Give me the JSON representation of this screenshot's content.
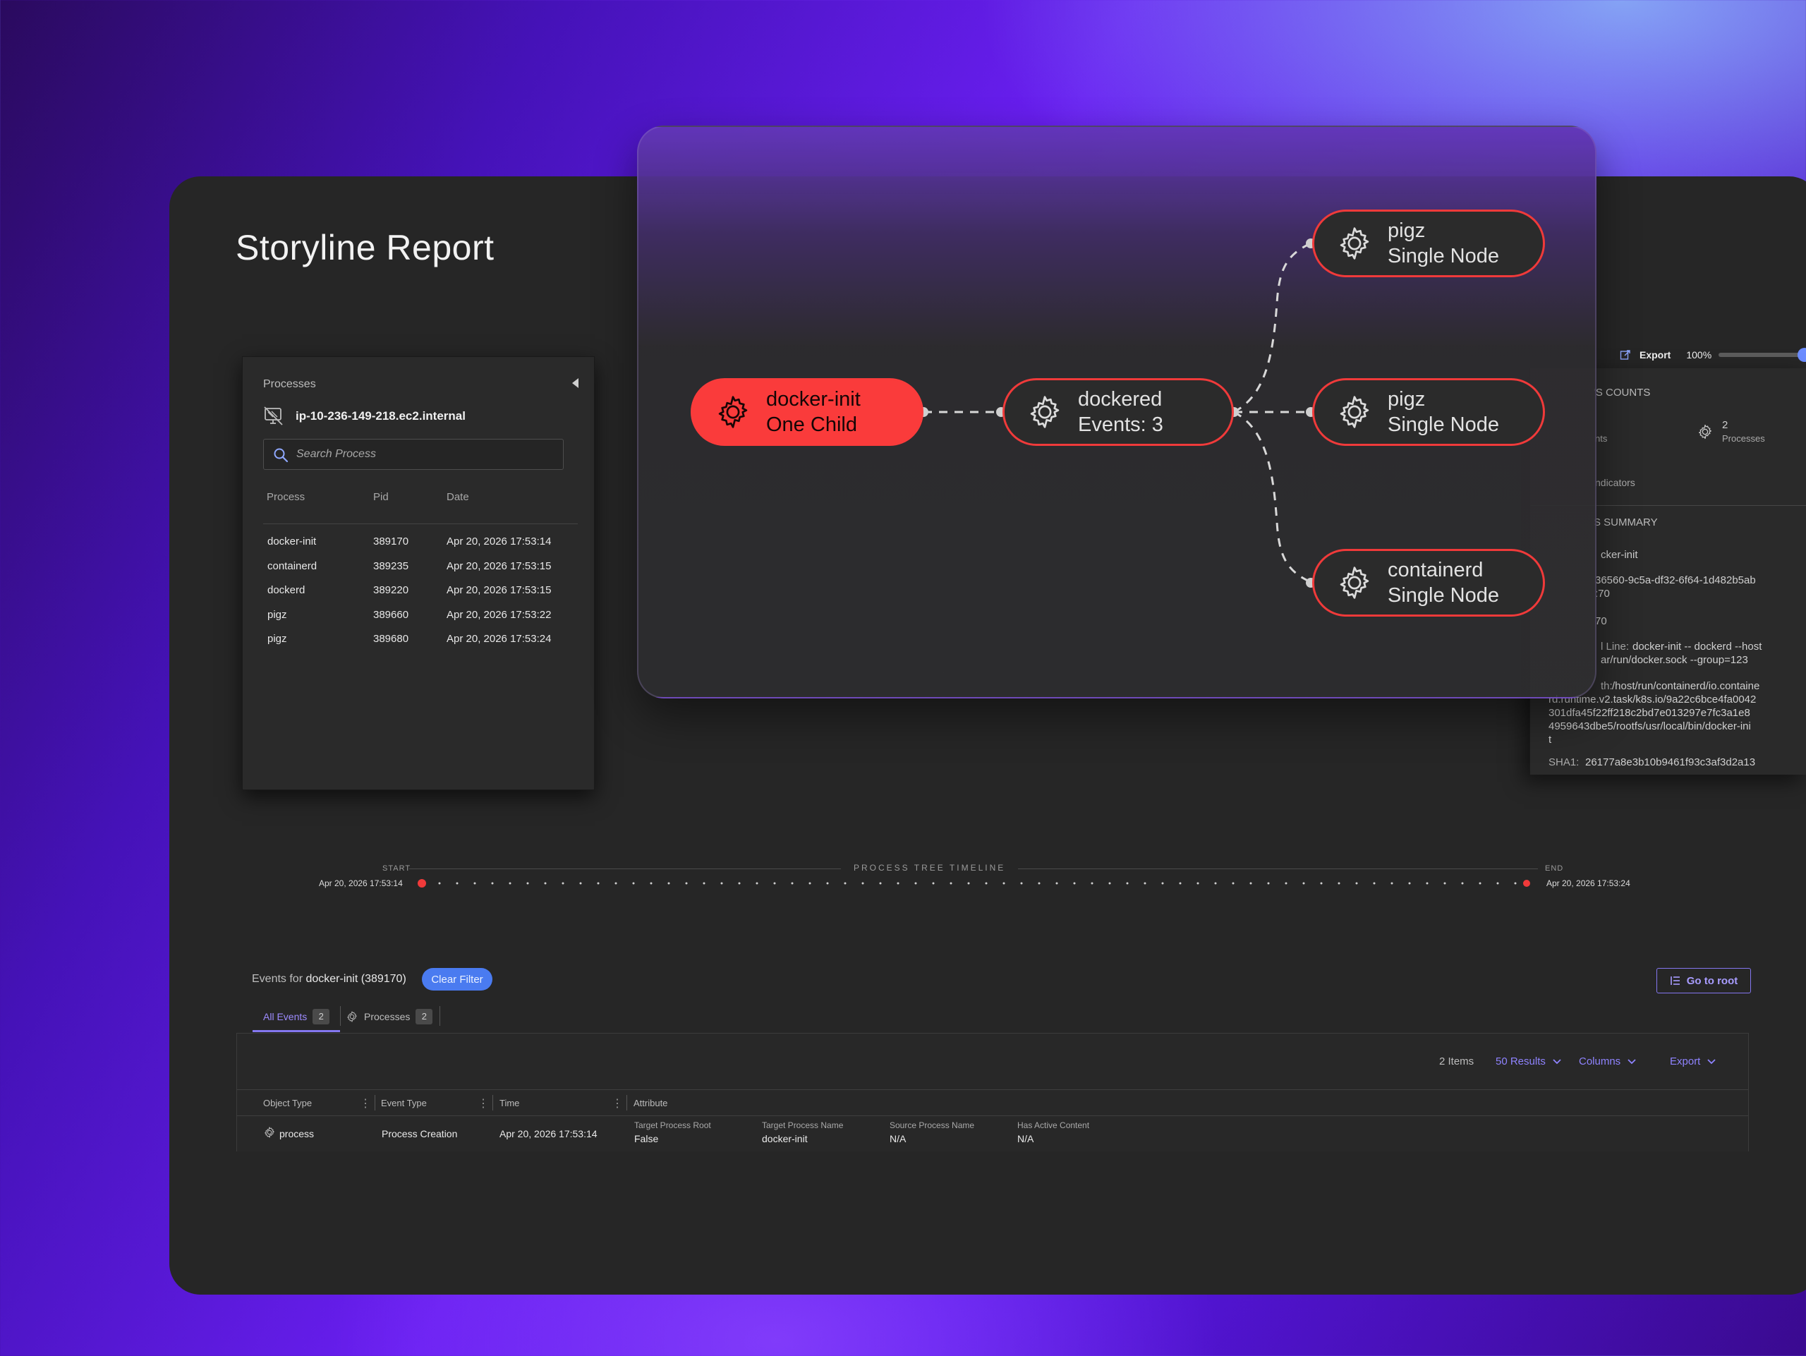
{
  "page": {
    "title": "Storyline Report"
  },
  "processes_panel": {
    "label": "Processes",
    "host": "ip-10-236-149-218.ec2.internal",
    "search_placeholder": "Search Process",
    "columns": [
      "Process",
      "Pid",
      "Date"
    ],
    "rows": [
      {
        "process": "docker-init",
        "pid": "389170",
        "date": "Apr 20, 2026 17:53:14"
      },
      {
        "process": "containerd",
        "pid": "389235",
        "date": "Apr 20, 2026 17:53:15"
      },
      {
        "process": "dockerd",
        "pid": "389220",
        "date": "Apr 20, 2026 17:53:15"
      },
      {
        "process": "pigz",
        "pid": "389660",
        "date": "Apr 20, 2026 17:53:22"
      },
      {
        "process": "pigz",
        "pid": "389680",
        "date": "Apr 20, 2026 17:53:24"
      }
    ]
  },
  "graph": {
    "nodes": [
      {
        "name": "docker-init",
        "sub": "One Child"
      },
      {
        "name": "dockered",
        "sub": "Events: 3"
      },
      {
        "name": "pigz",
        "sub": "Single Node"
      },
      {
        "name": "pigz",
        "sub": "Single Node"
      },
      {
        "name": "containerd",
        "sub": "Single Node"
      }
    ]
  },
  "toolbar": {
    "export_label": "Export",
    "zoom": "100%"
  },
  "details": {
    "counts_header": "'S COUNTS",
    "counts_left": "nts",
    "processes_count": "2",
    "processes_label": "Processes",
    "indicators": "ndicators",
    "summary_header": "S SUMMARY",
    "name_value": "cker-init",
    "uid_line1": "36560-9c5a-df32-6f64-1d482b5ab",
    "uid_line2": ":70",
    "pid_value": "70",
    "cmd_label": "l Line:",
    "cmd_value_1": "docker-init -- dockerd --host",
    "cmd_value_2": "ar/run/docker.sock --group=123",
    "path_label": "th:",
    "path_value_1": "/host/run/containerd/io.containe",
    "path_value_2": "rd.runtime.v2.task/k8s.io/9a22c6bce4fa0042",
    "path_value_3": "301dfa45f22ff218c2bd7e013297e7fc3a1e8",
    "path_value_4": "4959643dbe5/rootfs/usr/local/bin/docker-ini",
    "path_value_5": "t",
    "sha_label": "SHA1:",
    "sha_value": "26177a8e3b10b9461f93c3af3d2a13"
  },
  "timeline": {
    "start_label": "START",
    "end_label": "END",
    "title": "PROCESS TREE TIMELINE",
    "start_date": "Apr 20, 2026 17:53:14",
    "end_date": "Apr 20, 2026 17:53:24"
  },
  "events": {
    "prefix": "Events for",
    "target": "docker-init (389170)",
    "clear_filter": "Clear Filter",
    "go_root": "Go to root",
    "tabs": [
      {
        "label": "All Events",
        "count": "2"
      },
      {
        "label": "Processes",
        "count": "2"
      }
    ],
    "items_count": "2 Items",
    "results": "50 Results",
    "columns_btn": "Columns",
    "export_btn": "Export",
    "headers": [
      "Object Type",
      "Event Type",
      "Time",
      "Attribute"
    ],
    "row": {
      "object_type": "process",
      "event_type": "Process Creation",
      "time": "Apr 20, 2026 17:53:14",
      "attributes": [
        {
          "label": "Target Process Root",
          "value": "False"
        },
        {
          "label": "Target Process Name",
          "value": "docker-init"
        },
        {
          "label": "Source Process Name",
          "value": "N/A"
        },
        {
          "label": "Has Active Content",
          "value": "N/A"
        }
      ]
    }
  },
  "colors": {
    "accent_red": "#fa3b3b",
    "accent_purple": "#8477f0",
    "accent_blue": "#4a7bf0"
  }
}
